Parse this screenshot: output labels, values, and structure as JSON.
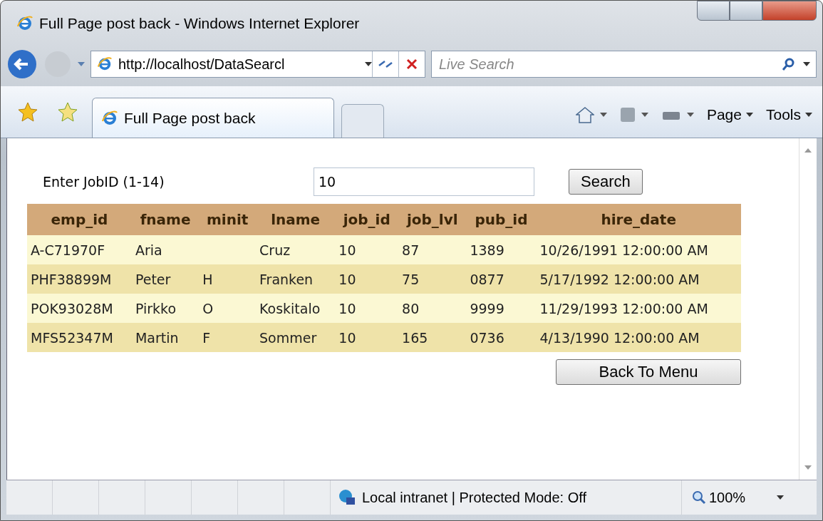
{
  "window": {
    "title": "Full Page post back - Windows Internet Explorer"
  },
  "address_bar": {
    "url": "http://localhost/DataSearcl"
  },
  "search": {
    "placeholder": "Live Search"
  },
  "tabs": [
    {
      "label": "Full Page post back",
      "selected": true
    }
  ],
  "command_bar": {
    "items": [
      {
        "kind": "home"
      },
      {
        "kind": "feeds"
      },
      {
        "kind": "print"
      },
      {
        "kind": "menu",
        "label": "Page"
      },
      {
        "kind": "menu",
        "label": "Tools"
      }
    ]
  },
  "form": {
    "label": "Enter JobID (1-14)",
    "value": "10",
    "button": "Search"
  },
  "table": {
    "columns": [
      "emp_id",
      "fname",
      "minit",
      "lname",
      "job_id",
      "job_lvl",
      "pub_id",
      "hire_date"
    ],
    "rows": [
      [
        "A-C71970F",
        "Aria",
        "",
        "Cruz",
        "10",
        "87",
        "1389",
        "10/26/1991 12:00:00 AM"
      ],
      [
        "PHF38899M",
        "Peter",
        "H",
        "Franken",
        "10",
        "75",
        "0877",
        "5/17/1992 12:00:00 AM"
      ],
      [
        "POK93028M",
        "Pirkko",
        "O",
        "Koskitalo",
        "10",
        "80",
        "9999",
        "11/29/1993 12:00:00 AM"
      ],
      [
        "MFS52347M",
        "Martin",
        "F",
        "Sommer",
        "10",
        "165",
        "0736",
        "4/13/1990 12:00:00 AM"
      ]
    ]
  },
  "back_button": "Back To  Menu",
  "status_bar": {
    "zone": "Local intranet | Protected Mode: Off",
    "zoom": "100%"
  }
}
